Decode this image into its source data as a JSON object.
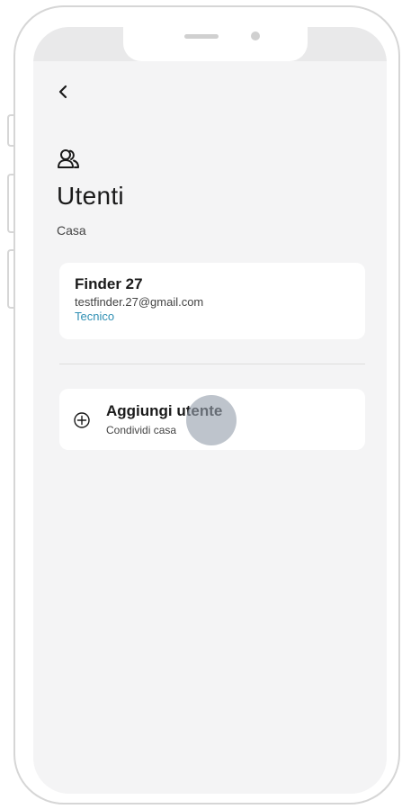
{
  "header": {
    "title": "Utenti",
    "subtitle": "Casa",
    "back_icon": "chevron-left-icon",
    "section_icon": "users-icon"
  },
  "users": [
    {
      "name": "Finder 27",
      "email": "testfinder.27@gmail.com",
      "role": "Tecnico"
    }
  ],
  "add_user": {
    "label": "Aggiungi utente",
    "sublabel": "Condividi casa",
    "icon": "plus-circle-icon"
  },
  "colors": {
    "background": "#f4f4f5",
    "card": "#ffffff",
    "accent": "#2f8fb3",
    "text": "#1a1a1a"
  }
}
